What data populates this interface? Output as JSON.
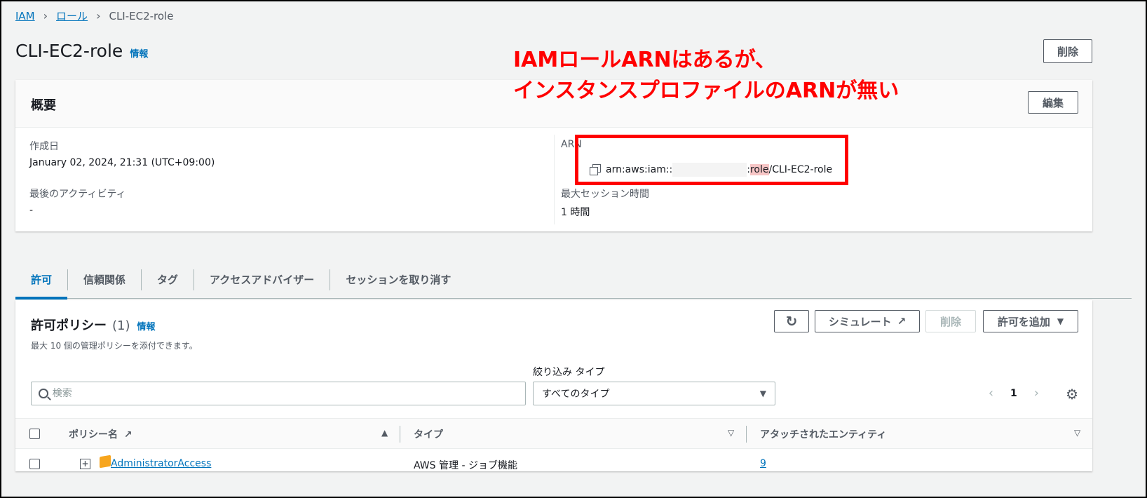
{
  "breadcrumb": {
    "items": [
      "IAM",
      "ロール"
    ],
    "current": "CLI-EC2-role"
  },
  "page": {
    "title": "CLI-EC2-role",
    "info": "情報",
    "delete_button": "削除"
  },
  "annotation": {
    "line1": "IAMロールARNはあるが、",
    "line2": "インスタンスプロファイルのARNが無い"
  },
  "summary": {
    "title": "概要",
    "edit_button": "編集",
    "created_label": "作成日",
    "created_value": "January 02, 2024, 21:31 (UTC+09:00)",
    "last_activity_label": "最後のアクティビティ",
    "last_activity_value": "-",
    "arn_label": "ARN",
    "arn_prefix": "arn:aws:iam::",
    "arn_sep": ":",
    "arn_role": "role",
    "arn_suffix": "/CLI-EC2-role",
    "max_session_label": "最大セッション時間",
    "max_session_value": "1 時間"
  },
  "tabs": [
    "許可",
    "信頼関係",
    "タグ",
    "アクセスアドバイザー",
    "セッションを取り消す"
  ],
  "policies": {
    "title": "許可ポリシー",
    "count": "(1)",
    "info": "情報",
    "description": "最大 10 個の管理ポリシーを添付できます。",
    "simulate_button": "シミュレート",
    "delete_button": "削除",
    "add_button": "許可を追加",
    "search_placeholder": "検索",
    "filter_label": "絞り込み タイプ",
    "filter_value": "すべてのタイプ",
    "page_number": "1",
    "columns": [
      "ポリシー名",
      "タイプ",
      "アタッチされたエンティティ"
    ],
    "rows": [
      {
        "name": "AdministratorAccess",
        "type": "AWS 管理 - ジョブ機能",
        "entities": "9"
      }
    ]
  }
}
